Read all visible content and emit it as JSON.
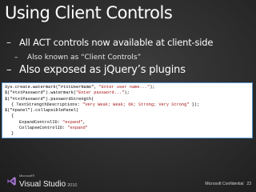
{
  "slide": {
    "title": "Using Client Controls",
    "bullets": [
      {
        "marker": "–",
        "text": "All ACT controls now available at client-side"
      },
      {
        "marker": "–",
        "text": "Also known as “Client Controls”"
      },
      {
        "marker": "–",
        "text": "Also exposed as jQuery’s plugins"
      }
    ],
    "code": {
      "lines": [
        {
          "prefix": "Sys.create.watermark(\"#txtUserName\", ",
          "string": "\"Enter user name...\"",
          "suffix": ");"
        },
        {
          "prefix": "$(\"#txtPassword\").watermark(",
          "string": "\"Enter password...\"",
          "suffix": ");"
        },
        {
          "prefix": "$(\"#txtPassword\").passwordStrength(",
          "string": "",
          "suffix": ""
        },
        {
          "prefix": "{ TextStrengthDescriptions: ",
          "string": "\"Very Weak; Weak; OK; Strong; Very Strong\"",
          "suffix": " });"
        },
        {
          "prefix": "$(\"#panel\").collapsiblePanel(",
          "string": "",
          "suffix": ""
        },
        {
          "prefix": "{",
          "string": "",
          "suffix": ""
        },
        {
          "prefix": "ExpandControlID: ",
          "string": "\"expand\"",
          "suffix": ","
        },
        {
          "prefix": "CollapseControlID: ",
          "string": "\"expand\"",
          "suffix": ""
        },
        {
          "prefix": "}",
          "string": "",
          "suffix": ""
        },
        {
          "prefix": "});",
          "string": "",
          "suffix": ""
        }
      ]
    },
    "footer": {
      "logo_microsoft": "Microsoft®",
      "logo_product": "Visual Studio",
      "logo_year": "2010",
      "confidential": "Microsoft Confidential",
      "page_number": "23"
    }
  }
}
